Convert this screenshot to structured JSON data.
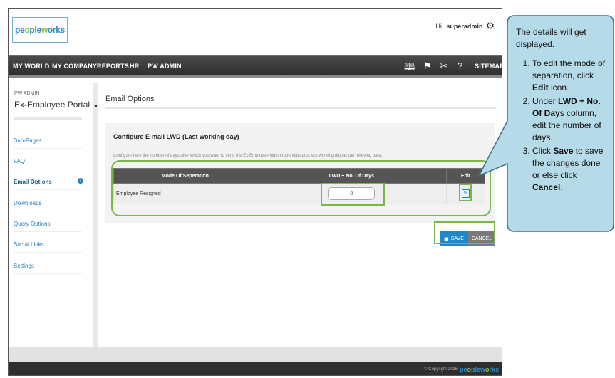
{
  "brand": {
    "logo_text_1": "pe",
    "logo_text_2": "o",
    "logo_text_3": "ple",
    "logo_text_4": "w",
    "logo_text_5": "o",
    "logo_text_6": "rks"
  },
  "header": {
    "greeting_prefix": "Hi,",
    "username": "superadmin",
    "settings_icon": "gear-icon"
  },
  "nav": {
    "items": [
      "MY WORLD",
      "MY COMPANY",
      "REPORTS",
      "HR",
      "PW ADMIN"
    ],
    "icons": [
      "book-icon",
      "flag-icon",
      "tools-icon",
      "help-icon"
    ],
    "sitemap": "SITEMAP"
  },
  "sidebar": {
    "subtitle": "PW ADMIN",
    "title": "Ex-Employee Portal",
    "links": [
      "Sub-Pages",
      "FAQ",
      "Email Options",
      "Downloads",
      "Query Options",
      "Social Links",
      "Settings"
    ],
    "active_link": "Email Options",
    "collapse_arrow": "◂"
  },
  "main": {
    "page_title": "Email Options",
    "config_title": "Configure E-mail LWD (Last working day)",
    "config_desc": "Configure here the number of days after which you want to send the Ex-Employee login credentials post last working day/actual relieving date.",
    "table": {
      "headers": [
        "Mode Of Seperation",
        "LWD + No. Of Days",
        "Edit"
      ],
      "rows": [
        {
          "mode": "Employee Resigned",
          "days": "0"
        }
      ]
    },
    "save_label": "SAVE",
    "cancel_label": "CANCEL"
  },
  "footer": {
    "copyright": "© Copyright 2016",
    "brand": "peopleworks"
  },
  "callout": {
    "intro": "The details will get displayed.",
    "step1_a": "To edit the mode of separation, click ",
    "step1_b": "Edit",
    "step1_c": " icon.",
    "step2_a": "Under ",
    "step2_b": "LWD + No. Of Day",
    "step2_c": "s column, edit the number of days.",
    "step3_a": "Click ",
    "step3_b": "Save",
    "step3_c": " to save the changes done or else click ",
    "step3_d": "Cancel",
    "step3_e": "."
  },
  "colors": {
    "accent": "#2a8dc5",
    "brand_green": "#8fbf3b",
    "highlight": "#7ab648",
    "callout_fill": "#b6dbe8",
    "callout_border": "#3a6f8a"
  }
}
